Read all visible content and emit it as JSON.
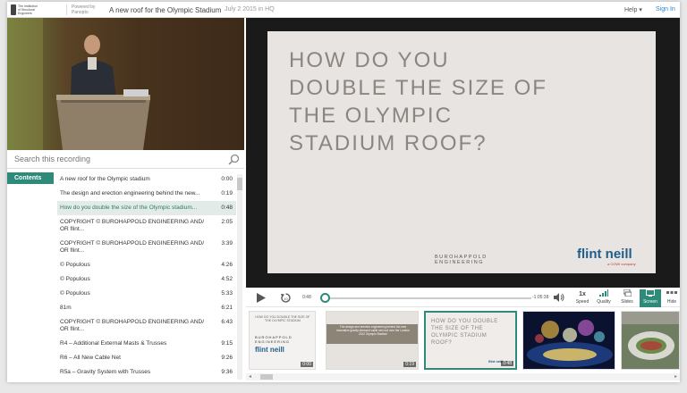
{
  "header": {
    "logo_text": "The Institution of Structural Engineers",
    "powered_by": "Powered by",
    "powered_brand": "Panopto",
    "title": "A new roof for the Olympic Stadium",
    "date": "July 2 2015 in HQ",
    "help_label": "Help ▾",
    "signin_label": "Sign In"
  },
  "search": {
    "placeholder": "Search this recording"
  },
  "contents": {
    "tab_label": "Contents",
    "rows": [
      {
        "label": "A new roof for the Olympic stadium",
        "time": "0:00"
      },
      {
        "label": "The design and erection engineering behind the new...",
        "time": "0:19"
      },
      {
        "label": "How do you double the size of the Olympic stadium...",
        "time": "0:48"
      },
      {
        "label": "COPYRIGHT © BUROHAPPOLD ENGINEERING AND/ OR flint...",
        "time": "2:05"
      },
      {
        "label": "COPYRIGHT © BUROHAPPOLD ENGINEERING AND/ OR flint...",
        "time": "3:39"
      },
      {
        "label": "© Populous",
        "time": "4:26"
      },
      {
        "label": "© Populous",
        "time": "4:52"
      },
      {
        "label": "© Populous",
        "time": "5:33"
      },
      {
        "label": "81m",
        "time": "6:21"
      },
      {
        "label": "COPYRIGHT © BUROHAPPOLD ENGINEERING AND/ OR flint...",
        "time": "6:43"
      },
      {
        "label": "R4 – Additional External Masts & Trusses",
        "time": "9:15"
      },
      {
        "label": "R6 – All New Cable Net",
        "time": "9:26"
      },
      {
        "label": "R5a – Gravity System with Trusses",
        "time": "9:36"
      }
    ]
  },
  "slide": {
    "title_lines": [
      "HOW DO YOU",
      "DOUBLE THE SIZE OF",
      "THE OLYMPIC",
      "STADIUM ROOF?"
    ],
    "burohappold": "BUROHAPPOLD",
    "engineering": "ENGINEERING",
    "flint": "flint neill",
    "flint_sub": "a COWI company"
  },
  "controls": {
    "elapsed": "0:48",
    "remaining": "-1:05:38",
    "progress": 0.012,
    "speed_value": "1x",
    "speed_label": "Speed",
    "quality_label": "Quality",
    "slides_label": "Slides",
    "screen_label": "Screen",
    "hide_label": "Hide"
  },
  "thumbnails": {
    "t1_time": "0:00",
    "t2_time": "0:19",
    "t3_time": "0:48",
    "t1_title": "HOW DO YOU DOUBLE THE SIZE OF THE OLYMPIC STADIUM",
    "t2_text": "The design and erection engineering behind the new innovative gravity stressed cable net roof over the London 2012 Olympic Stadium",
    "t3_title": "HOW DO YOU DOUBLE THE SIZE OF THE OLYMPIC STADIUM ROOF?"
  },
  "colors": {
    "accent": "#2e8b7a",
    "link": "#2a86d1"
  }
}
